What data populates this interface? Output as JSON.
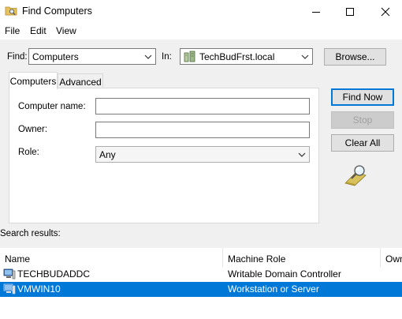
{
  "window": {
    "title": "Find Computers",
    "icon": "find-folder-icon"
  },
  "menu": {
    "items": [
      "File",
      "Edit",
      "View"
    ]
  },
  "find_bar": {
    "find_label": "Find:",
    "find_value": "Computers",
    "in_label": "In:",
    "in_value": "TechBudFrst.local",
    "browse_label": "Browse..."
  },
  "tabs": [
    {
      "label": "Computers",
      "active": true
    },
    {
      "label": "Advanced",
      "active": false
    }
  ],
  "form": {
    "computer_name_label": "Computer name:",
    "computer_name_value": "",
    "owner_label": "Owner:",
    "owner_value": "",
    "role_label": "Role:",
    "role_value": "Any"
  },
  "actions": {
    "find_now": "Find Now",
    "stop": "Stop",
    "clear_all": "Clear All"
  },
  "results": {
    "label": "Search results:",
    "columns": [
      "Name",
      "Machine Role",
      "Own"
    ],
    "rows": [
      {
        "name": "TECHBUDADDC",
        "role": "Writable Domain Controller",
        "selected": false
      },
      {
        "name": "VMWIN10",
        "role": "Workstation or Server",
        "selected": true
      }
    ]
  },
  "colors": {
    "selection": "#0078d7",
    "dialog_bg": "#f0f0f0"
  }
}
